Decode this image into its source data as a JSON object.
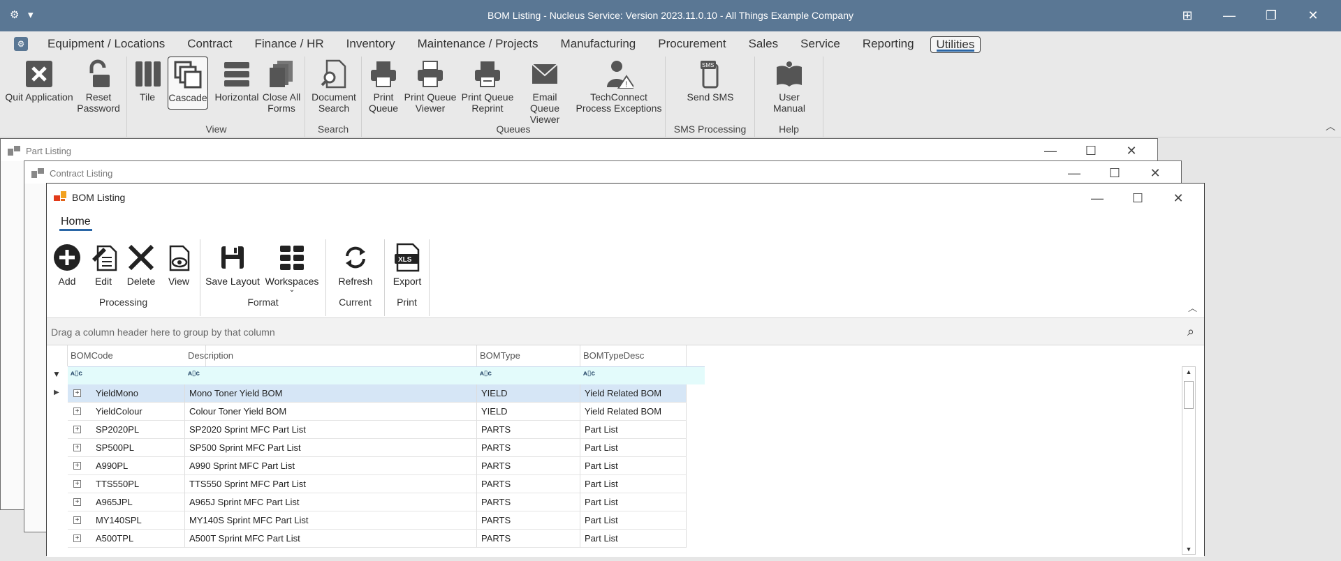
{
  "titlebar": {
    "title": "BOM Listing - Nucleus Service: Version 2023.11.0.10 - All Things Example Company",
    "gear_glyph": "⚙",
    "dropdown_glyph": "▾"
  },
  "menu": {
    "items": [
      "Equipment / Locations",
      "Contract",
      "Finance / HR",
      "Inventory",
      "Maintenance / Projects",
      "Manufacturing",
      "Procurement",
      "Sales",
      "Service",
      "Reporting",
      "Utilities"
    ],
    "active": "Utilities"
  },
  "ribbon": {
    "groups": {
      "app_label": "",
      "view_label": "View",
      "search_label": "Search",
      "queues_label": "Queues",
      "sms_label": "SMS Processing",
      "help_label": "Help"
    },
    "buttons": {
      "quit": "Quit Application",
      "reset_1": "Reset",
      "reset_2": "Password",
      "tile": "Tile",
      "cascade": "Cascade",
      "horizontal": "Horizontal",
      "close_all_1": "Close All",
      "close_all_2": "Forms",
      "doc_search_1": "Document",
      "doc_search_2": "Search",
      "print_queue_1": "Print",
      "print_queue_2": "Queue",
      "pq_viewer_1": "Print Queue",
      "pq_viewer_2": "Viewer",
      "pq_reprint_1": "Print Queue",
      "pq_reprint_2": "Reprint",
      "email_queue_1": "Email Queue",
      "email_queue_2": "Viewer",
      "techconnect_1": "TechConnect",
      "techconnect_2": "Process Exceptions",
      "send_sms": "Send SMS",
      "user_manual": "User Manual"
    }
  },
  "windows": {
    "part_listing": "Part Listing",
    "contract_listing": "Contract Listing",
    "bom_listing": "BOM Listing"
  },
  "bom": {
    "tab": "Home",
    "buttons": {
      "add": "Add",
      "edit": "Edit",
      "delete": "Delete",
      "view": "View",
      "save_layout": "Save Layout",
      "workspaces": "Workspaces",
      "refresh": "Refresh",
      "export": "Export"
    },
    "groups": {
      "processing": "Processing",
      "format": "Format",
      "current": "Current",
      "print": "Print"
    },
    "group_hint": "Drag a column header here to group by that column",
    "filter_glyph": "ᴀ▯c",
    "columns": [
      "BOMCode",
      "Description",
      "BOMType",
      "BOMTypeDesc"
    ],
    "rows": [
      [
        "YieldMono",
        "Mono Toner Yield BOM",
        "YIELD",
        "Yield Related BOM"
      ],
      [
        "YieldColour",
        "Colour Toner Yield BOM",
        "YIELD",
        "Yield Related BOM"
      ],
      [
        "SP2020PL",
        "SP2020 Sprint MFC Part List",
        "PARTS",
        "Part List"
      ],
      [
        "SP500PL",
        "SP500 Sprint MFC Part List",
        "PARTS",
        "Part List"
      ],
      [
        "A990PL",
        "A990 Sprint MFC Part List",
        "PARTS",
        "Part List"
      ],
      [
        "TTS550PL",
        "TTS550 Sprint MFC Part List",
        "PARTS",
        "Part List"
      ],
      [
        "A965JPL",
        "A965J Sprint MFC Part List",
        "PARTS",
        "Part List"
      ],
      [
        "MY140SPL",
        "MY140S Sprint MFC Part List",
        "PARTS",
        "Part List"
      ],
      [
        "A500TPL",
        "A500T Sprint MFC Part List",
        "PARTS",
        "Part List"
      ]
    ]
  },
  "colors": {
    "titlebar": "#5a7794",
    "accent": "#2a66a6",
    "selected_row": "#d6e6f6",
    "filter_row": "#e3fbfb"
  }
}
